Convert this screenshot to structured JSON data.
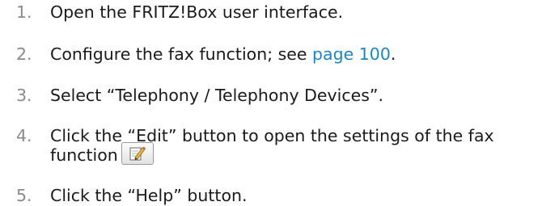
{
  "steps": [
    {
      "number": "1.",
      "text": "Open the FRITZ!Box user interface."
    },
    {
      "number": "2.",
      "text_before": "Configure the fax function; see ",
      "link": "page 100",
      "text_after": "."
    },
    {
      "number": "3.",
      "text": "Select “Telephony / Telephony Devices”."
    },
    {
      "number": "4.",
      "text_line1": "Click the “Edit” button to open the settings of the fax",
      "text_line2": "function",
      "button_icon": "edit-notepad-pencil-icon"
    },
    {
      "number": "5.",
      "text": "Click the “Help” button."
    }
  ]
}
